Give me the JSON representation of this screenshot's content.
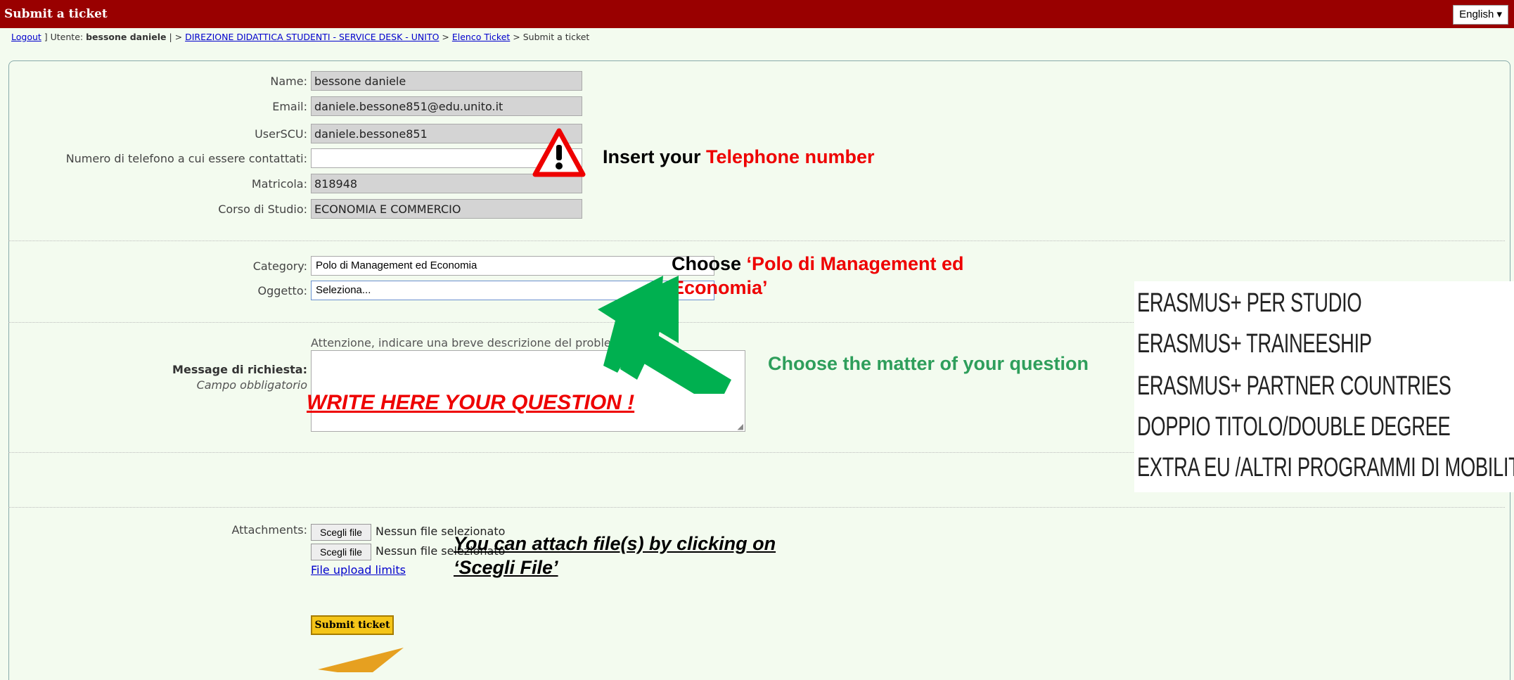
{
  "header": {
    "title": "Submit a ticket",
    "language": "English ▾"
  },
  "breadcrumb": {
    "logout": "Logout",
    "sep1": " ] Utente: ",
    "user": "bessone daniele",
    "sep2": " | > ",
    "desk": "DIREZIONE DIDATTICA STUDENTI - SERVICE DESK - UNITO",
    "sep3": " > ",
    "list": "Elenco Ticket",
    "sep4": " > Submit a ticket"
  },
  "form": {
    "name_label": "Name:",
    "name_value": "bessone daniele",
    "email_label": "Email:",
    "email_value": "daniele.bessone851@edu.unito.it",
    "userscu_label": "UserSCU:",
    "userscu_value": "daniele.bessone851",
    "phone_label": "Numero di telefono a cui essere contattati:",
    "phone_value": "",
    "matricola_label": "Matricola:",
    "matricola_value": "818948",
    "corso_label": "Corso di Studio:",
    "corso_value": "ECONOMIA E COMMERCIO",
    "category_label": "Category:",
    "category_value": "Polo di Management ed Economia",
    "oggetto_label": "Oggetto:",
    "oggetto_value": "Seleziona...",
    "attention_text": "Attenzione, indicare una breve descrizione del problem",
    "message_label": "Message di richiesta:",
    "message_required": "Campo obbligatorio",
    "attachments_label": "Attachments:",
    "choose_file": "Scegli file",
    "no_file": "Nessun file selezionato",
    "upload_limits": "File upload limits",
    "submit": "Submit ticket"
  },
  "annotations": {
    "telephone_prefix": "Insert your ",
    "telephone_highlight": "Telephone number",
    "category_prefix": "Choose ",
    "category_highlight_1": "‘Polo di Management ed",
    "category_highlight_2": "Economia’",
    "matter": "Choose the matter of your question",
    "write_question": "WRITE HERE YOUR QUESTION !",
    "attach_1": "You can attach file(s) by clicking on",
    "attach_2": "‘Scegli File’"
  },
  "subjects": [
    "ERASMUS+ PER STUDIO",
    "ERASMUS+ TRAINEESHIP",
    "ERASMUS+ PARTNER COUNTRIES",
    "DOPPIO TITOLO/DOUBLE DEGREE",
    "EXTRA EU /ALTRI PROGRAMMI DI MOBILITA'"
  ],
  "colors": {
    "header": "#990000",
    "background": "#f3fbef",
    "annotation_red": "#ee0000",
    "annotation_green": "#2e9e5b",
    "arrow_green": "#00b050",
    "arrow_orange": "#e6a020",
    "submit_button": "#f5c518"
  }
}
